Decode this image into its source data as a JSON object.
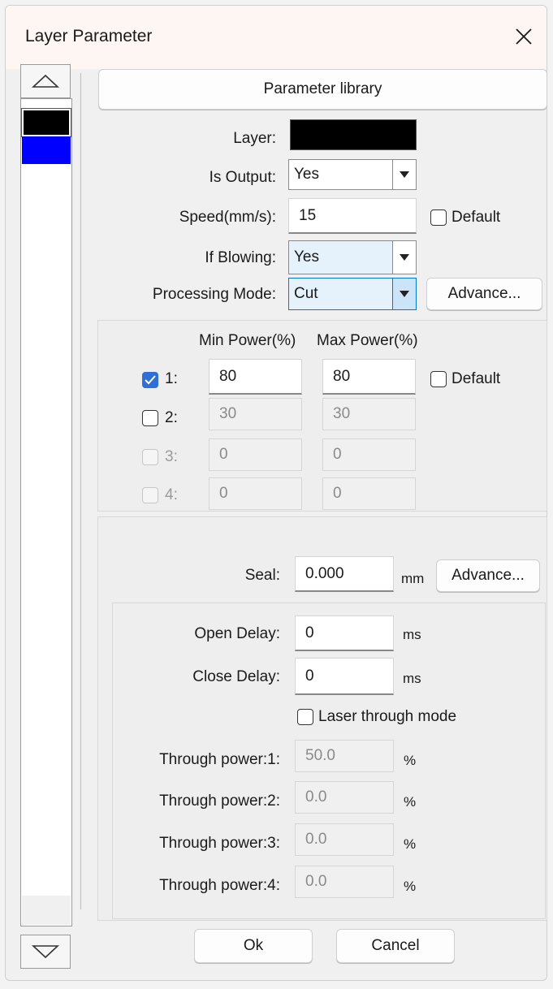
{
  "window": {
    "title": "Layer Parameter"
  },
  "layers": {
    "colors": [
      "#000000",
      "#0000ff"
    ]
  },
  "toolbar": {
    "parameter_library": "Parameter library"
  },
  "params": {
    "layer_label": "Layer:",
    "layer_color": "#000000",
    "is_output_label": "Is Output:",
    "is_output_value": "Yes",
    "speed_label": "Speed(mm/s):",
    "speed_value": "15",
    "speed_default_label": "Default",
    "if_blowing_label": "If Blowing:",
    "if_blowing_value": "Yes",
    "processing_mode_label": "Processing Mode:",
    "processing_mode_value": "Cut",
    "advance_label": "Advance..."
  },
  "power": {
    "min_header": "Min Power(%)",
    "max_header": "Max Power(%)",
    "default_label": "Default",
    "rows": [
      {
        "label": "1:",
        "checked": true,
        "enabled": true,
        "min": "80",
        "max": "80"
      },
      {
        "label": "2:",
        "checked": false,
        "enabled": true,
        "min": "30",
        "max": "30"
      },
      {
        "label": "3:",
        "checked": false,
        "enabled": false,
        "min": "0",
        "max": "0"
      },
      {
        "label": "4:",
        "checked": false,
        "enabled": false,
        "min": "0",
        "max": "0"
      }
    ]
  },
  "seal": {
    "label": "Seal:",
    "value": "0.000",
    "unit": "mm",
    "advance_label": "Advance..."
  },
  "delays": {
    "open_label": "Open Delay:",
    "open_value": "0",
    "close_label": "Close Delay:",
    "close_value": "0",
    "unit": "ms",
    "laser_through_label": "Laser through mode"
  },
  "through_power": {
    "unit": "%",
    "rows": [
      {
        "label": "Through power:1:",
        "value": "50.0"
      },
      {
        "label": "Through power:2:",
        "value": "0.0"
      },
      {
        "label": "Through power:3:",
        "value": "0.0"
      },
      {
        "label": "Through power:4:",
        "value": "0.0"
      }
    ]
  },
  "footer": {
    "ok_label": "Ok",
    "cancel_label": "Cancel"
  },
  "icons": {
    "close": "close-icon",
    "up": "triangle-up-icon",
    "down": "triangle-down-icon",
    "dropdown": "chevron-down-icon",
    "check": "check-icon"
  },
  "colors": {
    "accent": "#2f6fd6",
    "focus": "#0078d4"
  }
}
